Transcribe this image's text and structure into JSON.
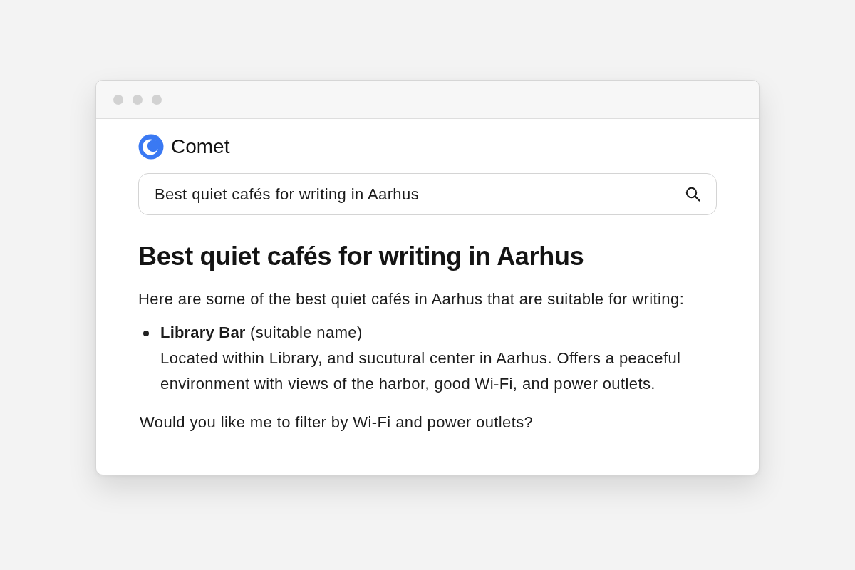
{
  "brand": {
    "name": "Comet"
  },
  "search": {
    "value": "Best quiet cafés for writing in Aarhus"
  },
  "answer": {
    "title": "Best quiet cafés for writing in Aarhus",
    "intro": "Here are some of the best quiet cafés in Aarhus that are suitable for writing:",
    "items": [
      {
        "heading": "**Library Bar** (suitable name)",
        "description": "Located within Library, and sucutural center in Aarhus. Offers a peaceful environment with views of the harbor, good Wi-Fi, and power outlets."
      }
    ],
    "follow_up": "Would you like me to filter by Wi-Fi and power outlets?"
  }
}
